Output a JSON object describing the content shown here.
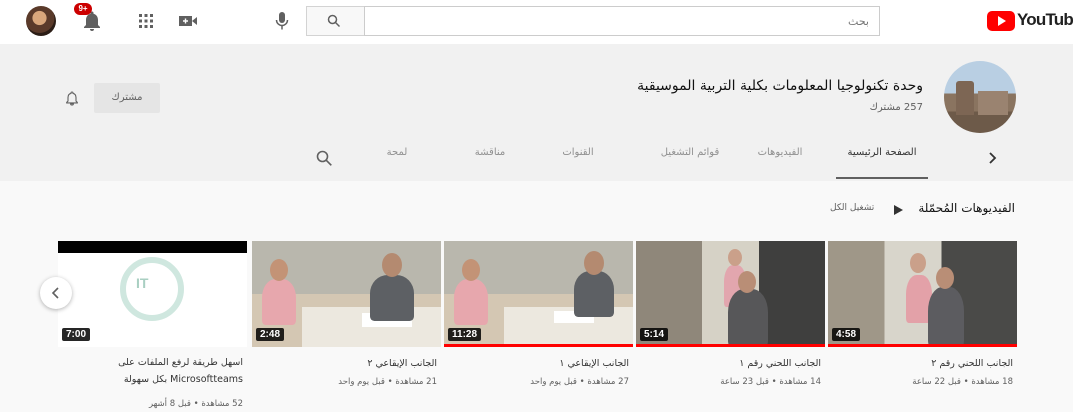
{
  "header": {
    "notifications_count": "9+",
    "search_placeholder": "بحث",
    "logo_text": "YouTube"
  },
  "channel": {
    "name": "وحدة تكنولوجيا المعلومات بكلية التربية الموسيقية",
    "subscribers": "257 مشترك",
    "subscribe_label": "مشترك"
  },
  "tabs": [
    {
      "label": "الصفحة الرئيسية",
      "active": true
    },
    {
      "label": "الفيديوهات",
      "active": false
    },
    {
      "label": "قوائم التشغيل",
      "active": false
    },
    {
      "label": "القنوات",
      "active": false
    },
    {
      "label": "مناقشة",
      "active": false
    },
    {
      "label": "لمحة",
      "active": false
    }
  ],
  "section": {
    "title": "الفيديوهات المُحمّلة",
    "play_all": "تشغيل الكل"
  },
  "videos": [
    {
      "title": "الجانب اللحني رقم ٢",
      "meta": "18 مشاهدة • قبل 22 ساعة",
      "duration": "4:58",
      "progress": 1.0
    },
    {
      "title": "الجانب اللحني رقم ١",
      "meta": "14 مشاهدة • قبل 23 ساعة",
      "duration": "5:14",
      "progress": 1.0
    },
    {
      "title": "الجانب الإيقاعي ١",
      "meta": "27 مشاهدة • قبل يوم واحد",
      "duration": "11:28",
      "progress": 1.0
    },
    {
      "title": "الجانب الإيقاعي ٢",
      "meta": "21 مشاهدة • قبل يوم واحد",
      "duration": "2:48",
      "progress": 0.0
    },
    {
      "title": "اسهل طريقة لرفع الملفات على Microsoftteams بكل سهولة",
      "meta": "52 مشاهدة • قبل 8 أشهر",
      "duration": "7:00",
      "progress": 0.0
    }
  ],
  "colors": {
    "accent": "#ff0000",
    "badge": "#cc0000"
  }
}
